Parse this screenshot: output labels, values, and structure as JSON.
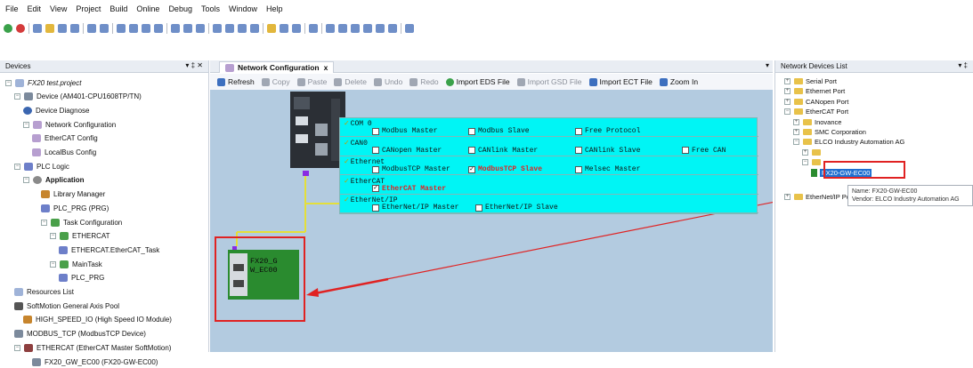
{
  "menu": [
    "File",
    "Edit",
    "View",
    "Project",
    "Build",
    "Online",
    "Debug",
    "Tools",
    "Window",
    "Help"
  ],
  "devices_panel": {
    "title": "Devices",
    "controls": "▾ ‡ ✕",
    "tree": [
      {
        "label": "FX20 test.project",
        "indent": 0,
        "icon": "doc",
        "twisty": "−"
      },
      {
        "label": "Device (AM401-CPU1608TP/TN)",
        "indent": 1,
        "icon": "dev",
        "twisty": "−"
      },
      {
        "label": "Device Diagnose",
        "indent": 2,
        "icon": "eye",
        "twisty": ""
      },
      {
        "label": "Network Configuration",
        "indent": 2,
        "icon": "net",
        "twisty": "−"
      },
      {
        "label": "EtherCAT Config",
        "indent": 3,
        "icon": "net",
        "twisty": ""
      },
      {
        "label": "LocalBus Config",
        "indent": 3,
        "icon": "net",
        "twisty": ""
      },
      {
        "label": "PLC Logic",
        "indent": 1,
        "icon": "prg",
        "twisty": "−"
      },
      {
        "label": "Application",
        "indent": 2,
        "icon": "app",
        "twisty": "−",
        "bold": true
      },
      {
        "label": "Library Manager",
        "indent": 4,
        "icon": "lib",
        "twisty": ""
      },
      {
        "label": "PLC_PRG (PRG)",
        "indent": 4,
        "icon": "prg",
        "twisty": ""
      },
      {
        "label": "Task Configuration",
        "indent": 4,
        "icon": "task",
        "twisty": "−"
      },
      {
        "label": "ETHERCAT",
        "indent": 5,
        "icon": "task",
        "twisty": "−"
      },
      {
        "label": "ETHERCAT.EtherCAT_Task",
        "indent": 6,
        "icon": "prg",
        "twisty": ""
      },
      {
        "label": "MainTask",
        "indent": 5,
        "icon": "task",
        "twisty": "−"
      },
      {
        "label": "PLC_PRG",
        "indent": 6,
        "icon": "prg",
        "twisty": ""
      },
      {
        "label": "Resources List",
        "indent": 1,
        "icon": "doc",
        "twisty": ""
      },
      {
        "label": "SoftMotion General Axis Pool",
        "indent": 1,
        "icon": "spd",
        "twisty": ""
      },
      {
        "label": "HIGH_SPEED_IO (High Speed IO Module)",
        "indent": 2,
        "icon": "lib",
        "twisty": ""
      },
      {
        "label": "MODBUS_TCP (ModbusTCP Device)",
        "indent": 1,
        "icon": "dev",
        "twisty": ""
      },
      {
        "label": "ETHERCAT (EtherCAT Master SoftMotion)",
        "indent": 1,
        "icon": "eth",
        "twisty": "−"
      },
      {
        "label": "FX20_GW_EC00 (FX20-GW-EC00)",
        "indent": 3,
        "icon": "dev",
        "twisty": ""
      }
    ]
  },
  "editor": {
    "tab_label": "Network Configuration",
    "tab_close": "x",
    "toolbar": [
      {
        "label": "Refresh",
        "enabled": true,
        "icon": "b"
      },
      {
        "label": "Copy",
        "enabled": false,
        "icon": ""
      },
      {
        "label": "Paste",
        "enabled": false,
        "icon": ""
      },
      {
        "label": "Delete",
        "enabled": false,
        "icon": ""
      },
      {
        "label": "Undo",
        "enabled": false,
        "icon": ""
      },
      {
        "label": "Redo",
        "enabled": false,
        "icon": ""
      },
      {
        "label": "Import EDS File",
        "enabled": true,
        "icon": "g"
      },
      {
        "label": "Import GSD File",
        "enabled": false,
        "icon": ""
      },
      {
        "label": "Import ECT File",
        "enabled": true,
        "icon": "b"
      },
      {
        "label": "Zoom In",
        "enabled": true,
        "icon": "b"
      }
    ],
    "protocols": [
      {
        "name": "COM 0",
        "options": [
          {
            "label": "Modbus Master",
            "checked": false,
            "highlight": false
          },
          {
            "label": "Modbus Slave",
            "checked": false,
            "highlight": false
          },
          {
            "label": "Free Protocol",
            "checked": false,
            "highlight": false
          }
        ]
      },
      {
        "name": "CAN0",
        "options": [
          {
            "label": "CANopen Master",
            "checked": false,
            "highlight": false
          },
          {
            "label": "CANlink Master",
            "checked": false,
            "highlight": false
          },
          {
            "label": "CANlink Slave",
            "checked": false,
            "highlight": false
          },
          {
            "label": "Free CAN",
            "checked": false,
            "highlight": false
          }
        ]
      },
      {
        "name": "Ethernet",
        "options": [
          {
            "label": "ModbusTCP Master",
            "checked": false,
            "highlight": false
          },
          {
            "label": "ModbusTCP Slave",
            "checked": true,
            "highlight": true
          },
          {
            "label": "Melsec Master",
            "checked": false,
            "highlight": false
          }
        ]
      },
      {
        "name": "EtherCAT",
        "options": [
          {
            "label": "EtherCAT Master",
            "checked": true,
            "highlight": true
          }
        ]
      },
      {
        "name": "EtherNet/IP",
        "options": [
          {
            "label": "EtherNet/IP Master",
            "checked": false,
            "highlight": false
          },
          {
            "label": "EtherNet/IP Slave",
            "checked": false,
            "highlight": false
          }
        ]
      }
    ],
    "slave_node_label": "FX20_G\nW_EC00"
  },
  "network_devices_panel": {
    "title": "Network Devices List",
    "controls": "▾ ‡",
    "items": [
      {
        "label": "Serial Port",
        "indent": 0,
        "twisty": "+"
      },
      {
        "label": "Ethernet Port",
        "indent": 0,
        "twisty": "+"
      },
      {
        "label": "CANopen Port",
        "indent": 0,
        "twisty": "+"
      },
      {
        "label": "EtherCAT Port",
        "indent": 0,
        "twisty": "−"
      },
      {
        "label": "Inovance",
        "indent": 1,
        "twisty": "+"
      },
      {
        "label": "SMC Corporation",
        "indent": 1,
        "twisty": "+"
      },
      {
        "label": "ELCO Industry Automation AG",
        "indent": 1,
        "twisty": "−"
      },
      {
        "label": "",
        "indent": 2,
        "twisty": "+"
      },
      {
        "label": "",
        "indent": 2,
        "twisty": "−"
      },
      {
        "label": "FX20-GW-EC00",
        "indent": 3,
        "twisty": "",
        "selected": true
      },
      {
        "label": "EtherNet/IP Port",
        "indent": 0,
        "twisty": "+"
      }
    ],
    "tooltip": {
      "name": "Name: FX20-GW-EC00",
      "vendor": "Vendor: ELCO Industry Automation AG"
    }
  },
  "colors": {
    "annotation_red": "#e02222",
    "protocol_bg": "#00f5f5",
    "canvas_bg": "#b3cbe0",
    "selected_bg": "#1f6fd0",
    "bus_yellow": "#e4df3a"
  }
}
